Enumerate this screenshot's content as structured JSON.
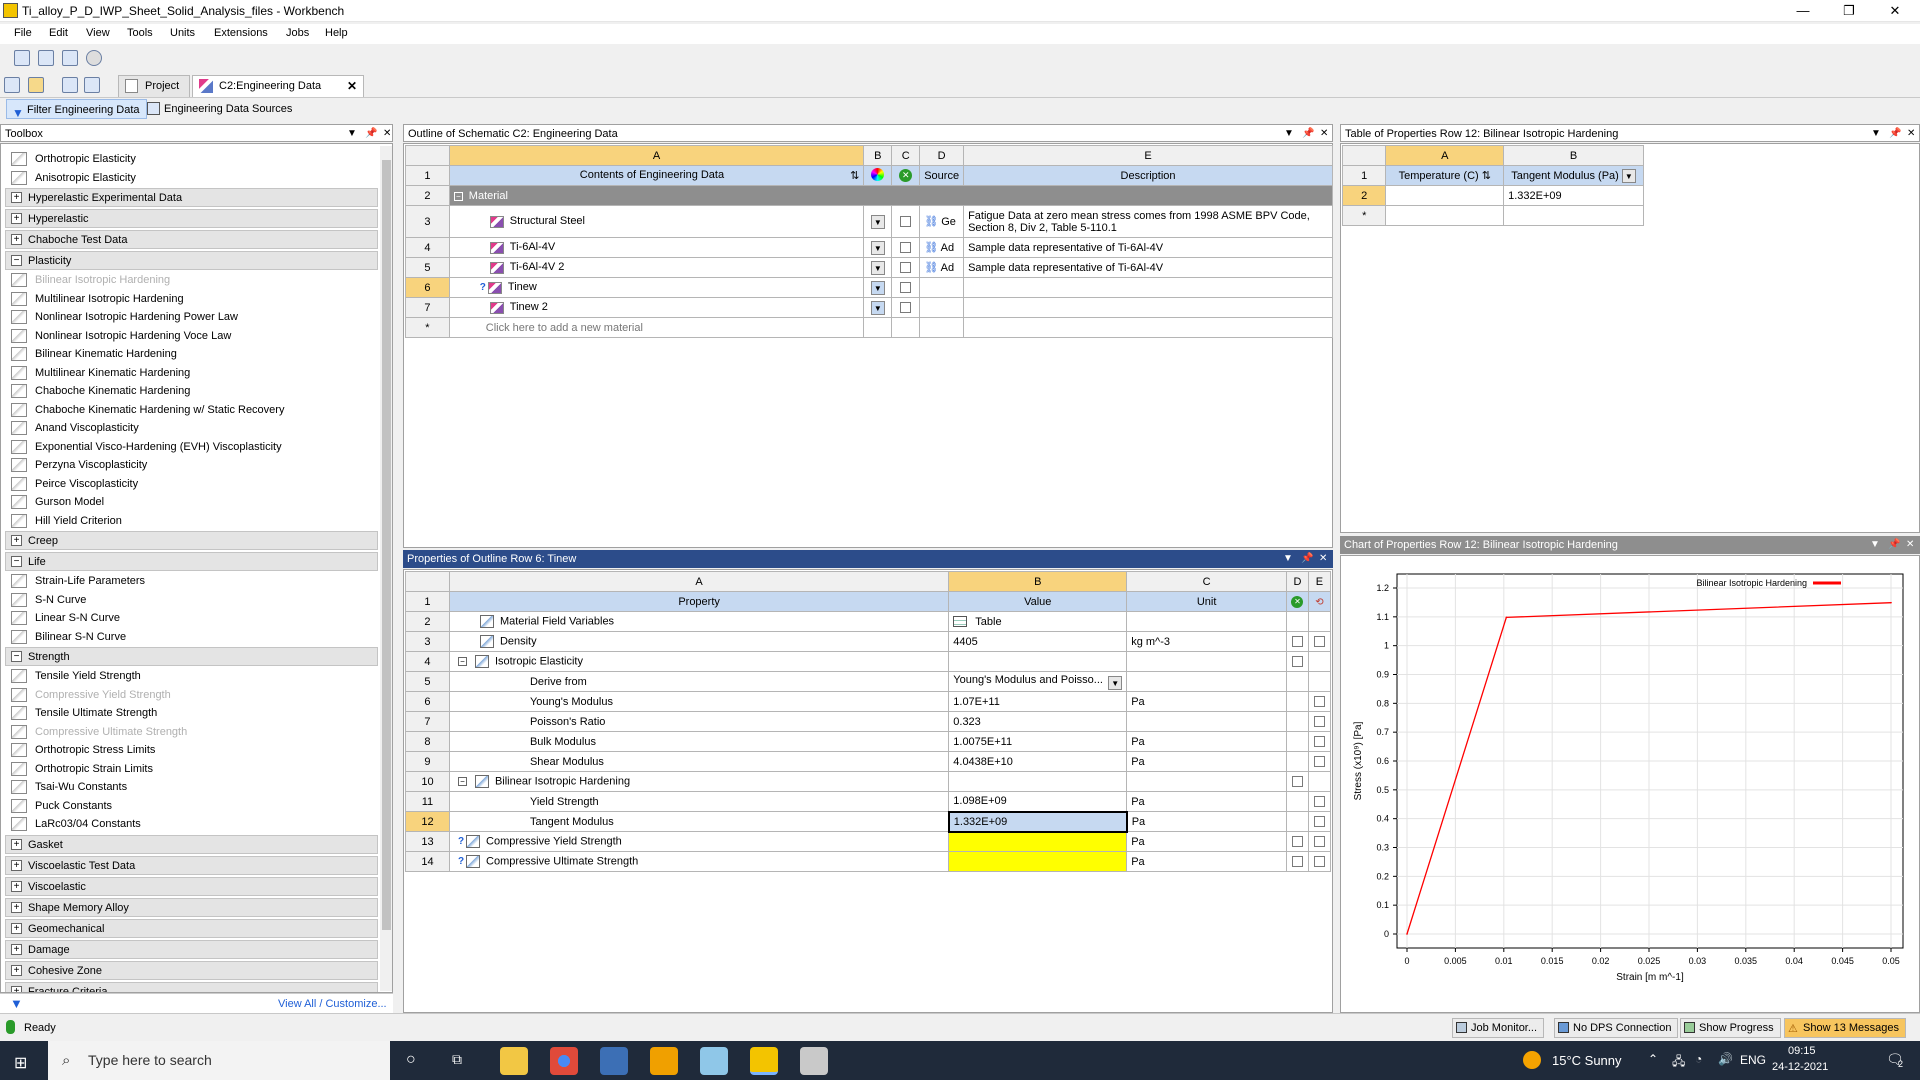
{
  "window": {
    "title": "Ti_alloy_P_D_IWP_Sheet_Solid_Analysis_files - Workbench"
  },
  "menu": [
    "File",
    "Edit",
    "View",
    "Tools",
    "Units",
    "Extensions",
    "Jobs",
    "Help"
  ],
  "tabs": {
    "project": "Project",
    "engdata": "C2:Engineering Data"
  },
  "toolbar2": {
    "filter": "Filter Engineering Data",
    "sources": "Engineering Data Sources"
  },
  "toolbox": {
    "title": "Toolbox",
    "items": [
      {
        "kind": "item",
        "label": "Orthotropic Elasticity",
        "disabled": false
      },
      {
        "kind": "item",
        "label": "Anisotropic Elasticity",
        "disabled": false
      },
      {
        "kind": "cat",
        "label": "Hyperelastic Experimental Data",
        "sign": "+"
      },
      {
        "kind": "cat",
        "label": "Hyperelastic",
        "sign": "+"
      },
      {
        "kind": "cat",
        "label": "Chaboche Test Data",
        "sign": "+"
      },
      {
        "kind": "cat",
        "label": "Plasticity",
        "sign": "−"
      },
      {
        "kind": "item",
        "label": "Bilinear Isotropic Hardening",
        "disabled": true
      },
      {
        "kind": "item",
        "label": "Multilinear Isotropic Hardening",
        "disabled": false
      },
      {
        "kind": "item",
        "label": "Nonlinear Isotropic Hardening Power Law",
        "disabled": false
      },
      {
        "kind": "item",
        "label": "Nonlinear Isotropic Hardening Voce Law",
        "disabled": false
      },
      {
        "kind": "item",
        "label": "Bilinear Kinematic Hardening",
        "disabled": false
      },
      {
        "kind": "item",
        "label": "Multilinear Kinematic Hardening",
        "disabled": false
      },
      {
        "kind": "item",
        "label": "Chaboche Kinematic Hardening",
        "disabled": false
      },
      {
        "kind": "item",
        "label": "Chaboche Kinematic Hardening w/ Static Recovery",
        "disabled": false
      },
      {
        "kind": "item",
        "label": "Anand Viscoplasticity",
        "disabled": false
      },
      {
        "kind": "item",
        "label": "Exponential Visco-Hardening (EVH) Viscoplasticity",
        "disabled": false
      },
      {
        "kind": "item",
        "label": "Perzyna Viscoplasticity",
        "disabled": false
      },
      {
        "kind": "item",
        "label": "Peirce Viscoplasticity",
        "disabled": false
      },
      {
        "kind": "item",
        "label": "Gurson Model",
        "disabled": false
      },
      {
        "kind": "item",
        "label": "Hill Yield Criterion",
        "disabled": false
      },
      {
        "kind": "cat",
        "label": "Creep",
        "sign": "+"
      },
      {
        "kind": "cat",
        "label": "Life",
        "sign": "−"
      },
      {
        "kind": "item",
        "label": "Strain-Life Parameters",
        "disabled": false
      },
      {
        "kind": "item",
        "label": "S-N Curve",
        "disabled": false
      },
      {
        "kind": "item",
        "label": "Linear S-N Curve",
        "disabled": false
      },
      {
        "kind": "item",
        "label": "Bilinear S-N Curve",
        "disabled": false
      },
      {
        "kind": "cat",
        "label": "Strength",
        "sign": "−"
      },
      {
        "kind": "item",
        "label": "Tensile Yield Strength",
        "disabled": false
      },
      {
        "kind": "item",
        "label": "Compressive Yield Strength",
        "disabled": true
      },
      {
        "kind": "item",
        "label": "Tensile Ultimate Strength",
        "disabled": false
      },
      {
        "kind": "item",
        "label": "Compressive Ultimate Strength",
        "disabled": true
      },
      {
        "kind": "item",
        "label": "Orthotropic Stress Limits",
        "disabled": false
      },
      {
        "kind": "item",
        "label": "Orthotropic Strain Limits",
        "disabled": false
      },
      {
        "kind": "item",
        "label": "Tsai-Wu Constants",
        "disabled": false
      },
      {
        "kind": "item",
        "label": "Puck Constants",
        "disabled": false
      },
      {
        "kind": "item",
        "label": "LaRc03/04 Constants",
        "disabled": false
      },
      {
        "kind": "cat",
        "label": "Gasket",
        "sign": "+"
      },
      {
        "kind": "cat",
        "label": "Viscoelastic Test Data",
        "sign": "+"
      },
      {
        "kind": "cat",
        "label": "Viscoelastic",
        "sign": "+"
      },
      {
        "kind": "cat",
        "label": "Shape Memory Alloy",
        "sign": "+"
      },
      {
        "kind": "cat",
        "label": "Geomechanical",
        "sign": "+"
      },
      {
        "kind": "cat",
        "label": "Damage",
        "sign": "+"
      },
      {
        "kind": "cat",
        "label": "Cohesive Zone",
        "sign": "+"
      },
      {
        "kind": "cat",
        "label": "Fracture Criteria",
        "sign": "+"
      }
    ],
    "footer_link": "View All / Customize..."
  },
  "outline": {
    "title": "Outline of Schematic C2: Engineering Data",
    "cols": [
      "A",
      "B",
      "C",
      "D",
      "E"
    ],
    "header": {
      "contents": "Contents of Engineering Data",
      "source": "Source",
      "description": "Description"
    },
    "group": "Material",
    "rows": [
      {
        "n": "3",
        "name": "Structural Steel",
        "src": "Ge",
        "desc1": "Fatigue Data at zero mean stress comes from 1998 ASME BPV Code,",
        "desc2": "Section 8, Div 2, Table 5-110.1"
      },
      {
        "n": "4",
        "name": "Ti-6Al-4V",
        "src": "Ad",
        "desc1": "Sample data representative of Ti-6Al-4V",
        "desc2": ""
      },
      {
        "n": "5",
        "name": "Ti-6Al-4V 2",
        "src": "Ad",
        "desc1": "Sample data representative of Ti-6Al-4V",
        "desc2": ""
      },
      {
        "n": "6",
        "name": "Tinew",
        "src": "",
        "desc1": "",
        "desc2": ""
      },
      {
        "n": "7",
        "name": "Tinew 2",
        "src": "",
        "desc1": "",
        "desc2": ""
      }
    ],
    "add_row": "Click here to add a new material"
  },
  "table_props": {
    "title": "Table of Properties Row 12: Bilinear Isotropic Hardening",
    "cols": [
      "A",
      "B"
    ],
    "h1": "Temperature (C)",
    "h2": "Tangent Modulus (Pa)",
    "row2_b": "1.332E+09"
  },
  "properties": {
    "title": "Properties of Outline Row 6: Tinew",
    "cols": [
      "A",
      "B",
      "C",
      "D",
      "E"
    ],
    "header": {
      "property": "Property",
      "value": "Value",
      "unit": "Unit"
    },
    "rows": [
      {
        "n": "2",
        "prop": "Material Field Variables",
        "value": "Table",
        "unit": "",
        "indent": 1
      },
      {
        "n": "3",
        "prop": "Density",
        "value": "4405",
        "unit": "kg m^-3",
        "indent": 1
      },
      {
        "n": "4",
        "prop": "Isotropic Elasticity",
        "value": "",
        "unit": "",
        "indent": 1
      },
      {
        "n": "5",
        "prop": "Derive from",
        "value": "Young's Modulus and Poisso...",
        "unit": "",
        "indent": 2
      },
      {
        "n": "6",
        "prop": "Young's Modulus",
        "value": "1.07E+11",
        "unit": "Pa",
        "indent": 2
      },
      {
        "n": "7",
        "prop": "Poisson's Ratio",
        "value": "0.323",
        "unit": "",
        "indent": 2
      },
      {
        "n": "8",
        "prop": "Bulk Modulus",
        "value": "1.0075E+11",
        "unit": "Pa",
        "indent": 2
      },
      {
        "n": "9",
        "prop": "Shear Modulus",
        "value": "4.0438E+10",
        "unit": "Pa",
        "indent": 2
      },
      {
        "n": "10",
        "prop": "Bilinear Isotropic Hardening",
        "value": "",
        "unit": "",
        "indent": 1
      },
      {
        "n": "11",
        "prop": "Yield Strength",
        "value": "1.098E+09",
        "unit": "Pa",
        "indent": 2
      },
      {
        "n": "12",
        "prop": "Tangent Modulus",
        "value": "1.332E+09",
        "unit": "Pa",
        "indent": 2
      },
      {
        "n": "13",
        "prop": "Compressive Yield Strength",
        "value": "",
        "unit": "Pa",
        "indent": 1
      },
      {
        "n": "14",
        "prop": "Compressive Ultimate Strength",
        "value": "",
        "unit": "Pa",
        "indent": 1
      }
    ]
  },
  "chart": {
    "title": "Chart of Properties Row 12: Bilinear Isotropic Hardening"
  },
  "chart_data": {
    "type": "line",
    "series": [
      {
        "name": "Bilinear Isotropic Hardening",
        "color": "#ff0000",
        "x": [
          0,
          0.0102617,
          0.05
        ],
        "y": [
          0,
          1.098,
          1.1491
        ]
      }
    ],
    "xlabel": "Strain  [m m^-1]",
    "ylabel": "Stress  (x10⁹)  [Pa]",
    "xlim": [
      0,
      0.05
    ],
    "ylim": [
      0,
      1.2
    ],
    "xticks": [
      "0",
      "0.005",
      "0.01",
      "0.015",
      "0.02",
      "0.025",
      "0.03",
      "0.035",
      "0.04",
      "0.045",
      "0.05"
    ],
    "yticks": [
      "0",
      "0.1",
      "0.2",
      "0.3",
      "0.4",
      "0.5",
      "0.6",
      "0.7",
      "0.8",
      "0.9",
      "1",
      "1.1",
      "1.2"
    ],
    "grid": true,
    "legend": "top-right"
  },
  "status": {
    "ready": "Ready",
    "job_monitor": "Job Monitor...",
    "dps": "No DPS Connection",
    "progress": "Show Progress",
    "messages": "Show 13 Messages"
  },
  "taskbar": {
    "search": "Type here to search",
    "weather": "15°C  Sunny",
    "lang": "ENG",
    "time": "09:15",
    "date": "24-12-2021",
    "badge": "2"
  }
}
